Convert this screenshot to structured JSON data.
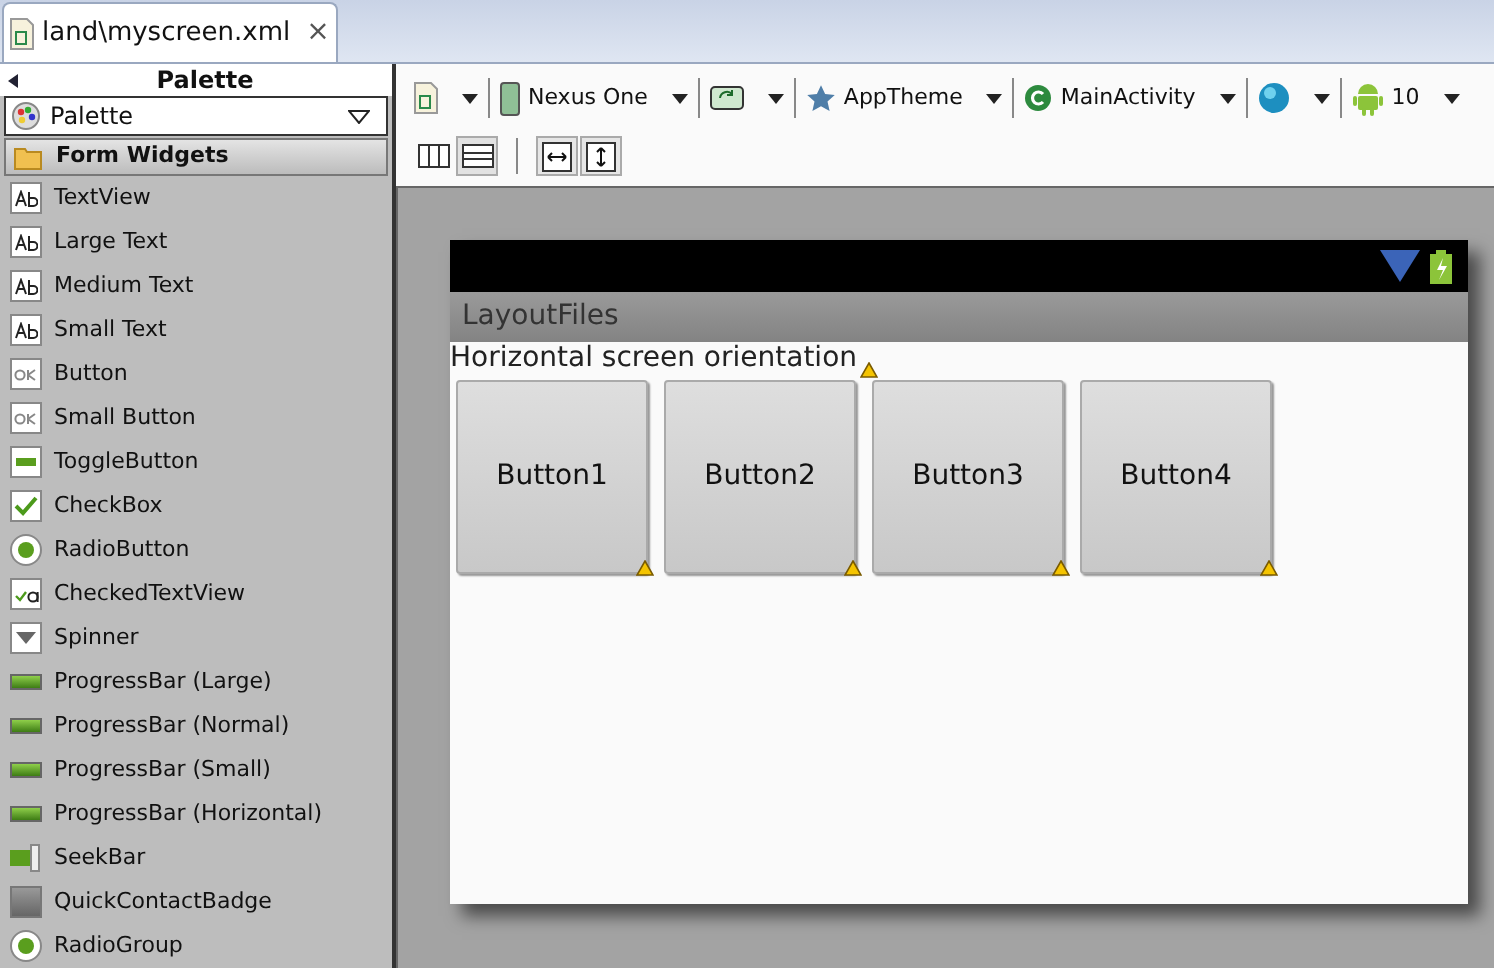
{
  "editor_tab": {
    "title": "land\\myscreen.xml",
    "close": "×"
  },
  "palette": {
    "title": "Palette",
    "dropdown": "Palette",
    "category": "Form Widgets",
    "items": [
      {
        "label": "TextView",
        "kind": "text"
      },
      {
        "label": "Large Text",
        "kind": "text"
      },
      {
        "label": "Medium Text",
        "kind": "text"
      },
      {
        "label": "Small Text",
        "kind": "text"
      },
      {
        "label": "Button",
        "kind": "button"
      },
      {
        "label": "Small Button",
        "kind": "button"
      },
      {
        "label": "ToggleButton",
        "kind": "toggle"
      },
      {
        "label": "CheckBox",
        "kind": "check"
      },
      {
        "label": "RadioButton",
        "kind": "radio"
      },
      {
        "label": "CheckedTextView",
        "kind": "checkedtext"
      },
      {
        "label": "Spinner",
        "kind": "spinner"
      },
      {
        "label": "ProgressBar (Large)",
        "kind": "progress"
      },
      {
        "label": "ProgressBar (Normal)",
        "kind": "progress"
      },
      {
        "label": "ProgressBar (Small)",
        "kind": "progress"
      },
      {
        "label": "ProgressBar (Horizontal)",
        "kind": "progress"
      },
      {
        "label": "SeekBar",
        "kind": "seek"
      },
      {
        "label": "QuickContactBadge",
        "kind": "badge"
      },
      {
        "label": "RadioGroup",
        "kind": "radio"
      }
    ]
  },
  "toolbar": {
    "items": [
      {
        "kind": "config"
      },
      {
        "kind": "device",
        "label": "Nexus One"
      },
      {
        "kind": "orientation"
      },
      {
        "kind": "theme",
        "label": "AppTheme"
      },
      {
        "kind": "activity",
        "label": "MainActivity"
      },
      {
        "kind": "locale"
      },
      {
        "kind": "api",
        "label": "10"
      }
    ],
    "layout_buttons": [
      {
        "kind": "columns",
        "selected": false
      },
      {
        "kind": "rows",
        "selected": true
      }
    ],
    "zoom_buttons": [
      {
        "kind": "horizontal"
      },
      {
        "kind": "vertical"
      }
    ]
  },
  "device": {
    "app_title": "LayoutFiles",
    "text": "Horizontal screen orientation",
    "buttons": [
      "Button1",
      "Button2",
      "Button3",
      "Button4"
    ]
  }
}
